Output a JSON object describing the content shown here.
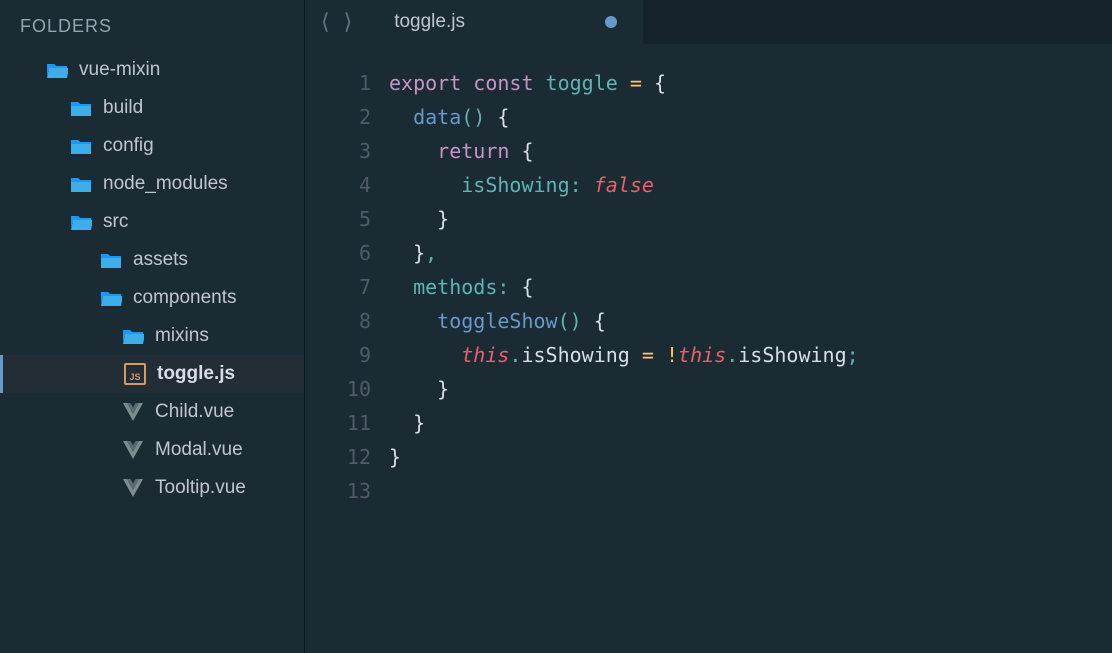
{
  "sidebar": {
    "header": "FOLDERS",
    "items": [
      {
        "label": "vue-mixin",
        "icon": "folder-open",
        "indent": 0,
        "active": false
      },
      {
        "label": "build",
        "icon": "folder",
        "indent": 1,
        "active": false
      },
      {
        "label": "config",
        "icon": "folder",
        "indent": 1,
        "active": false
      },
      {
        "label": "node_modules",
        "icon": "folder",
        "indent": 1,
        "active": false
      },
      {
        "label": "src",
        "icon": "folder-open",
        "indent": 1,
        "active": false
      },
      {
        "label": "assets",
        "icon": "folder",
        "indent": 2,
        "active": false
      },
      {
        "label": "components",
        "icon": "folder-open",
        "indent": 2,
        "active": false
      },
      {
        "label": "mixins",
        "icon": "folder-open",
        "indent": 3,
        "active": false
      },
      {
        "label": "toggle.js",
        "icon": "js",
        "indent": 4,
        "active": true
      },
      {
        "label": "Child.vue",
        "icon": "vue",
        "indent": 3,
        "active": false
      },
      {
        "label": "Modal.vue",
        "icon": "vue",
        "indent": 3,
        "active": false
      },
      {
        "label": "Tooltip.vue",
        "icon": "vue",
        "indent": 3,
        "active": false
      }
    ]
  },
  "tabs": {
    "active": {
      "label": "toggle.js",
      "dirty": true
    }
  },
  "editor": {
    "lineCount": 13,
    "tokenLines": [
      [
        {
          "t": "export ",
          "c": "tok-kw"
        },
        {
          "t": "const ",
          "c": "tok-kw2"
        },
        {
          "t": "toggle",
          "c": "tok-name"
        },
        {
          "t": " ",
          "c": ""
        },
        {
          "t": "=",
          "c": "tok-op"
        },
        {
          "t": " ",
          "c": ""
        },
        {
          "t": "{",
          "c": "tok-brace"
        }
      ],
      [
        {
          "t": "  ",
          "c": ""
        },
        {
          "t": "data",
          "c": "tok-fn"
        },
        {
          "t": "()",
          "c": "tok-punct"
        },
        {
          "t": " ",
          "c": ""
        },
        {
          "t": "{",
          "c": "tok-brace"
        }
      ],
      [
        {
          "t": "    ",
          "c": ""
        },
        {
          "t": "return ",
          "c": "tok-kw"
        },
        {
          "t": "{",
          "c": "tok-brace"
        }
      ],
      [
        {
          "t": "      ",
          "c": ""
        },
        {
          "t": "isShowing",
          "c": "tok-name"
        },
        {
          "t": ":",
          "c": "tok-punct"
        },
        {
          "t": " ",
          "c": ""
        },
        {
          "t": "false",
          "c": "tok-bool"
        }
      ],
      [
        {
          "t": "    ",
          "c": ""
        },
        {
          "t": "}",
          "c": "tok-brace"
        }
      ],
      [
        {
          "t": "  ",
          "c": ""
        },
        {
          "t": "}",
          "c": "tok-brace"
        },
        {
          "t": ",",
          "c": "tok-punct"
        }
      ],
      [
        {
          "t": "  ",
          "c": ""
        },
        {
          "t": "methods",
          "c": "tok-name"
        },
        {
          "t": ":",
          "c": "tok-punct"
        },
        {
          "t": " ",
          "c": ""
        },
        {
          "t": "{",
          "c": "tok-brace"
        }
      ],
      [
        {
          "t": "    ",
          "c": ""
        },
        {
          "t": "toggleShow",
          "c": "tok-fn"
        },
        {
          "t": "()",
          "c": "tok-punct"
        },
        {
          "t": " ",
          "c": ""
        },
        {
          "t": "{",
          "c": "tok-brace"
        }
      ],
      [
        {
          "t": "      ",
          "c": ""
        },
        {
          "t": "this",
          "c": "tok-this"
        },
        {
          "t": ".",
          "c": "tok-punct"
        },
        {
          "t": "isShowing",
          "c": "tok-prop"
        },
        {
          "t": " ",
          "c": ""
        },
        {
          "t": "=",
          "c": "tok-op"
        },
        {
          "t": " ",
          "c": ""
        },
        {
          "t": "!",
          "c": "tok-op"
        },
        {
          "t": "this",
          "c": "tok-this"
        },
        {
          "t": ".",
          "c": "tok-punct"
        },
        {
          "t": "isShowing",
          "c": "tok-prop"
        },
        {
          "t": ";",
          "c": "tok-punct"
        }
      ],
      [
        {
          "t": "    ",
          "c": ""
        },
        {
          "t": "}",
          "c": "tok-brace"
        }
      ],
      [
        {
          "t": "  ",
          "c": ""
        },
        {
          "t": "}",
          "c": "tok-brace"
        }
      ],
      [
        {
          "t": "}",
          "c": "tok-brace"
        }
      ],
      []
    ]
  },
  "icons": {
    "jsBadge": "JS"
  }
}
